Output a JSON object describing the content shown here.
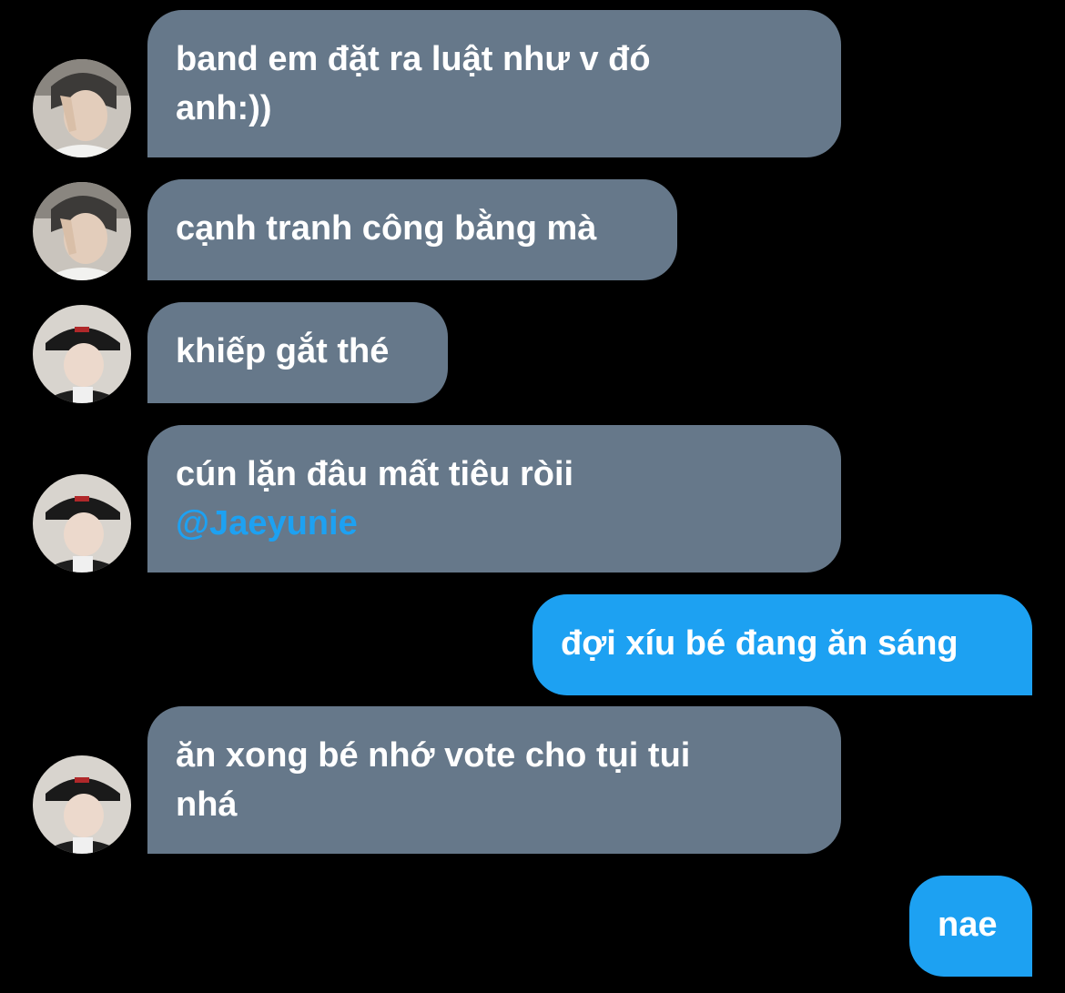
{
  "conversation": {
    "messages": [
      {
        "direction": "incoming",
        "sender_avatar": "avatar-user-a",
        "lines": [
          "band em đặt ra luật như v đó",
          "anh:))"
        ]
      },
      {
        "direction": "incoming",
        "sender_avatar": "avatar-user-a",
        "lines": [
          "cạnh tranh công bằng mà"
        ]
      },
      {
        "direction": "incoming",
        "sender_avatar": "avatar-user-b",
        "lines": [
          "khiếp gắt thé"
        ]
      },
      {
        "direction": "incoming",
        "sender_avatar": "avatar-user-b",
        "lines": [
          "cún lặn đâu mất tiêu ròii"
        ],
        "mention": "@Jaeyunie"
      },
      {
        "direction": "outgoing",
        "lines": [
          "đợi xíu bé đang ăn sáng"
        ]
      },
      {
        "direction": "incoming",
        "sender_avatar": "avatar-user-b",
        "lines": [
          "ăn xong bé nhớ vote cho tụi tui",
          "nhá"
        ]
      },
      {
        "direction": "outgoing",
        "lines": [
          "nae"
        ]
      }
    ]
  },
  "colors": {
    "background": "#000000",
    "incoming_bubble": "#66788a",
    "outgoing_bubble": "#1da1f2",
    "mention": "#1da1f2",
    "text": "#ffffff"
  }
}
